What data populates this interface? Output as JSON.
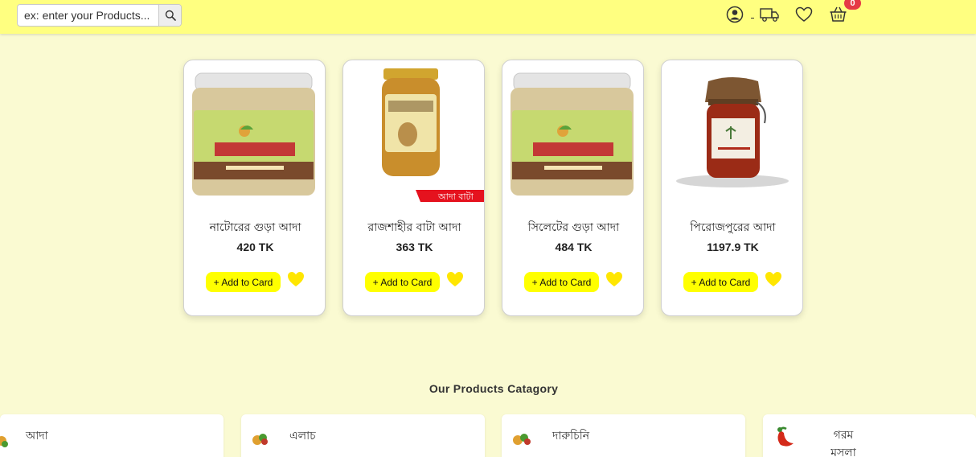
{
  "header": {
    "search_placeholder": "ex: enter your Products...",
    "cart_count": "0",
    "icons": [
      "search-icon",
      "user-icon",
      "truck-icon",
      "heart-icon",
      "basket-icon"
    ]
  },
  "products": [
    {
      "name": "নাটোরের গুড়া আদা",
      "price": "420 TK",
      "add_label": "+ Add to Card"
    },
    {
      "name": "রাজশাহীর বাটা আদা",
      "price": "363 TK",
      "add_label": "+ Add to Card",
      "ribbon": "আদা বাটা"
    },
    {
      "name": "সিলেটের গুড়া আদা",
      "price": "484 TK",
      "add_label": "+ Add to Card"
    },
    {
      "name": "পিরোজপুরের আদা",
      "price": "1197.9 TK",
      "add_label": "+ Add to Card"
    }
  ],
  "categories_section": {
    "title": "Our Products Catagory",
    "items": [
      {
        "label": "আদা"
      },
      {
        "label": "এলাচ"
      },
      {
        "label": "দারুচিনি"
      },
      {
        "label": "গরম মসলা"
      }
    ]
  },
  "colors": {
    "page_bg": "#fafad2",
    "header_bg": "#ffff80",
    "button": "#ffff00",
    "heart": "#ffe600",
    "badge": "#e53945"
  }
}
